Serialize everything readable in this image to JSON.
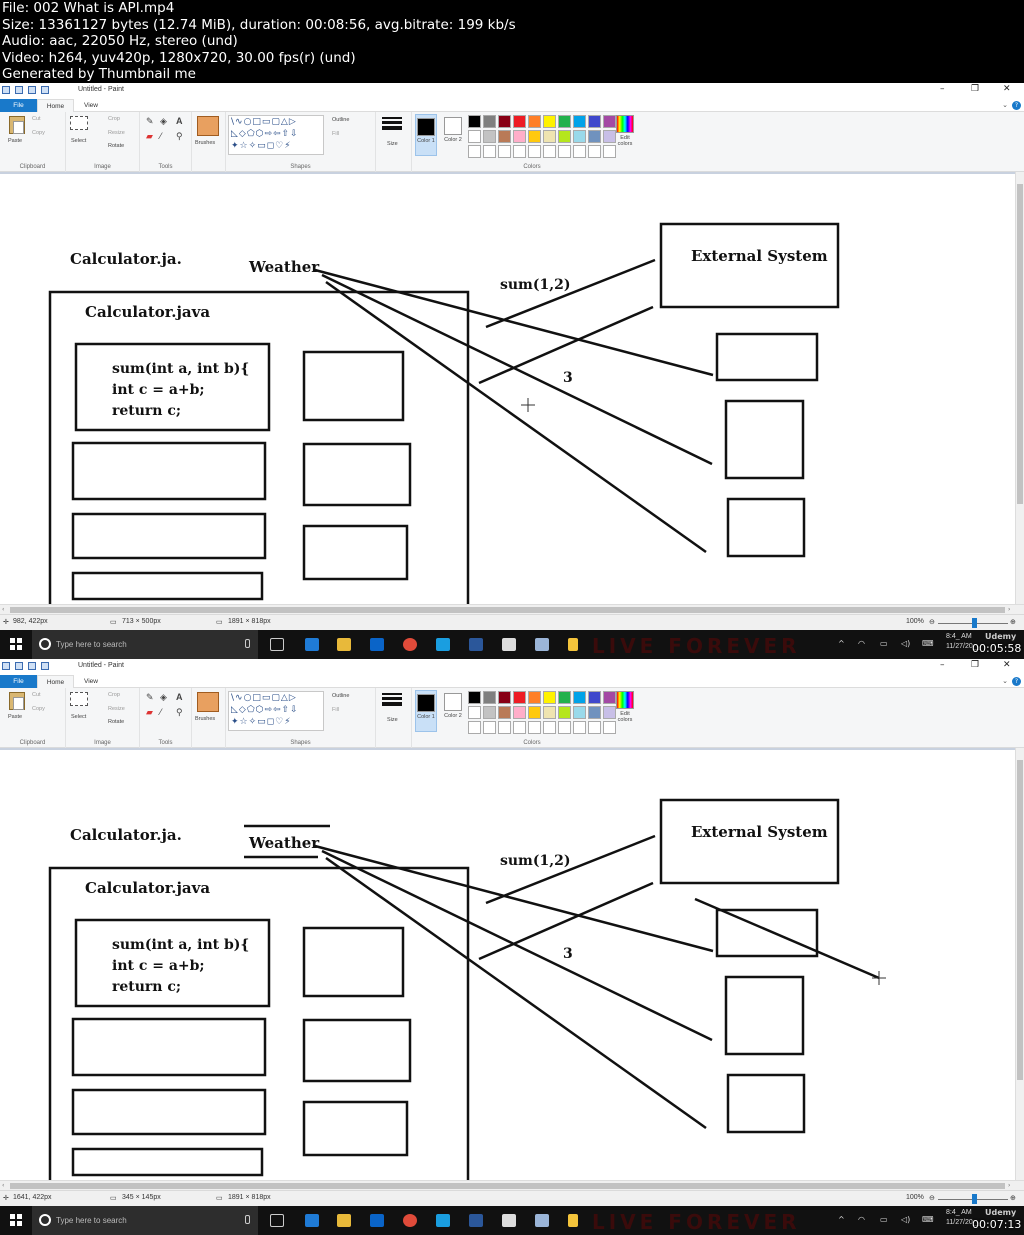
{
  "info": {
    "lines": [
      "File: 002 What is API.mp4",
      "Size: 13361127 bytes (12.74 MiB), duration: 00:08:56, avg.bitrate: 199 kb/s",
      "Audio: aac, 22050 Hz, stereo (und)",
      "Video: h264, yuv420p, 1280x720, 30.00 fps(r) (und)",
      "Generated by Thumbnail me"
    ]
  },
  "app": {
    "title": "Untitled - Paint",
    "tabs": [
      "File",
      "Home",
      "View"
    ],
    "ribbon": {
      "clipboard": {
        "paste": "Paste",
        "cut": "Cut",
        "copy": "Copy",
        "group": "Clipboard"
      },
      "image": {
        "select": "Select",
        "crop": "Crop",
        "resize": "Resize",
        "rotate": "Rotate",
        "group": "Image"
      },
      "tools": {
        "group": "Tools",
        "brushes": "Brushes"
      },
      "shapes": {
        "outline": "Outline",
        "fill": "Fill",
        "group": "Shapes"
      },
      "size": "Size",
      "color1": "Color 1",
      "color2": "Color 2",
      "colors_group": "Colors",
      "edit_colors": "Edit colors"
    },
    "palette": [
      "#000000",
      "#7f7f7f",
      "#880015",
      "#ed1c24",
      "#ff7f27",
      "#fff200",
      "#22b14c",
      "#00a2e8",
      "#3f48cc",
      "#a349a4",
      "#ffffff",
      "#c3c3c3",
      "#b97a57",
      "#ffaec9",
      "#ffc90e",
      "#efe4b0",
      "#b5e61d",
      "#99d9ea",
      "#7092be",
      "#c8bfe7",
      "#ffffff",
      "#ffffff",
      "#ffffff",
      "#ffffff",
      "#ffffff",
      "#ffffff",
      "#ffffff",
      "#ffffff",
      "#ffffff",
      "#ffffff"
    ],
    "color1": "#000000",
    "color2": "#ffffff"
  },
  "drawing": {
    "label_calc_outer": "Calculator.ja.",
    "label_weather": "Weather",
    "label_calc_inner": "Calculator.java",
    "code_line1": "sum(int a, int b){",
    "code_line2": "int c = a+b;",
    "code_line3": "return c;",
    "label_external": "External System",
    "label_sum": "sum(1,2)",
    "label_three": "3"
  },
  "taskbar": {
    "search_placeholder": "Type here to search",
    "time": "8:4_ AM",
    "date": "11/27/20__",
    "brand": "Udemy"
  },
  "frames": [
    {
      "cursor_pos": "982, 422px",
      "selection_size": "713 × 500px",
      "image_size": "1891 × 818px",
      "zoom": "100%",
      "timestamp": "00:05:58"
    },
    {
      "cursor_pos": "1641, 422px",
      "selection_size": "345 × 145px",
      "image_size": "1891 × 818px",
      "zoom": "100%",
      "timestamp": "00:07:13"
    }
  ]
}
